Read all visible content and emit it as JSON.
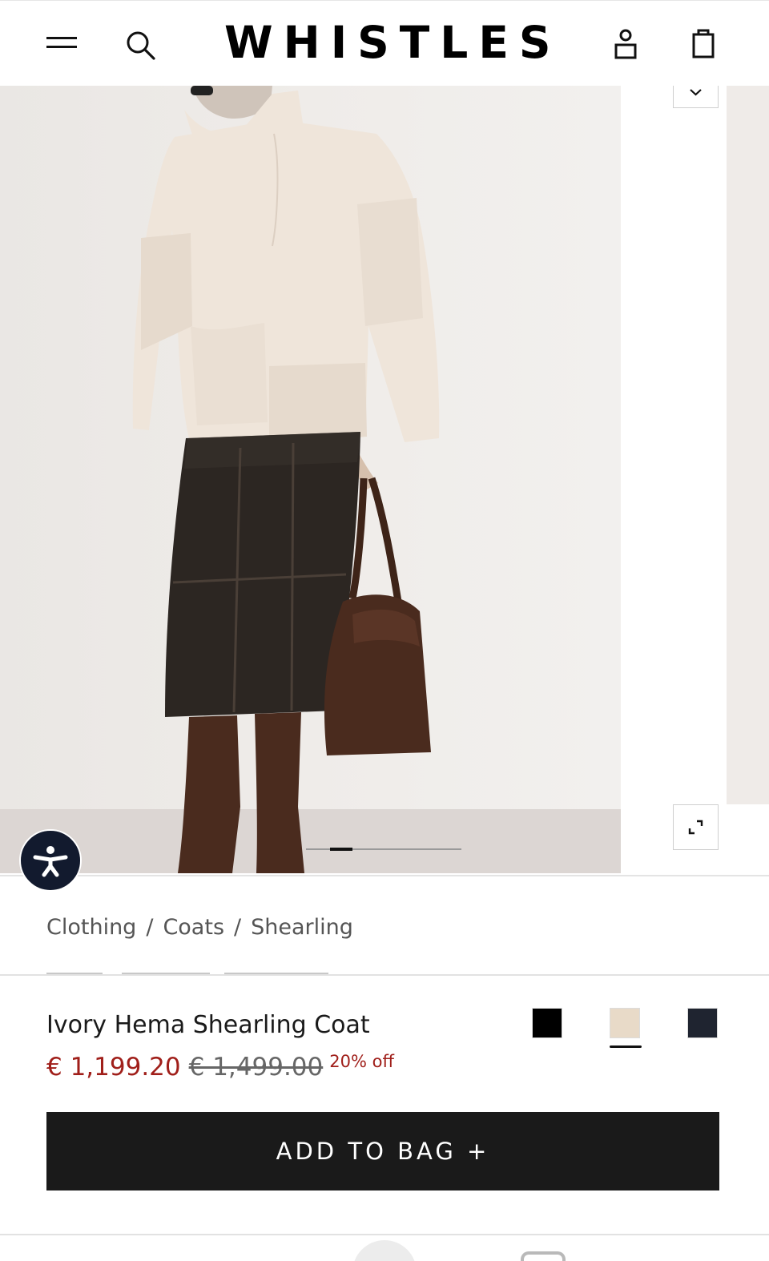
{
  "header": {
    "logo_text": "WHISTLES",
    "icons": [
      "menu-icon",
      "search-icon",
      "account-icon",
      "shopping-bag-icon"
    ]
  },
  "gallery": {
    "image_alt": "Model wearing ivory shearling coat with dark leather midi skirt, brown suede knee boots and a brown suede tote bag",
    "slide_index": 1,
    "slide_count": 7,
    "icons": [
      "chevron-down-icon",
      "expand-icon",
      "accessibility-icon"
    ]
  },
  "breadcrumb": {
    "items": [
      "Clothing",
      "Coats",
      "Shearling"
    ],
    "separator": "/"
  },
  "product": {
    "name": "Ivory Hema Shearling Coat",
    "price_sale": "€ 1,199.20",
    "price_original": "€ 1,499.00",
    "discount": "20% off",
    "swatches": [
      {
        "color": "#000000",
        "selected": false
      },
      {
        "color": "#e8dac8",
        "selected": true
      },
      {
        "color": "#1f2430",
        "selected": false
      }
    ],
    "add_to_bag_label": "ADD TO BAG +"
  },
  "colors": {
    "sale_red": "#a01f1a",
    "button_dark": "#1a1a1a",
    "a11y_navy": "#121a2e"
  }
}
